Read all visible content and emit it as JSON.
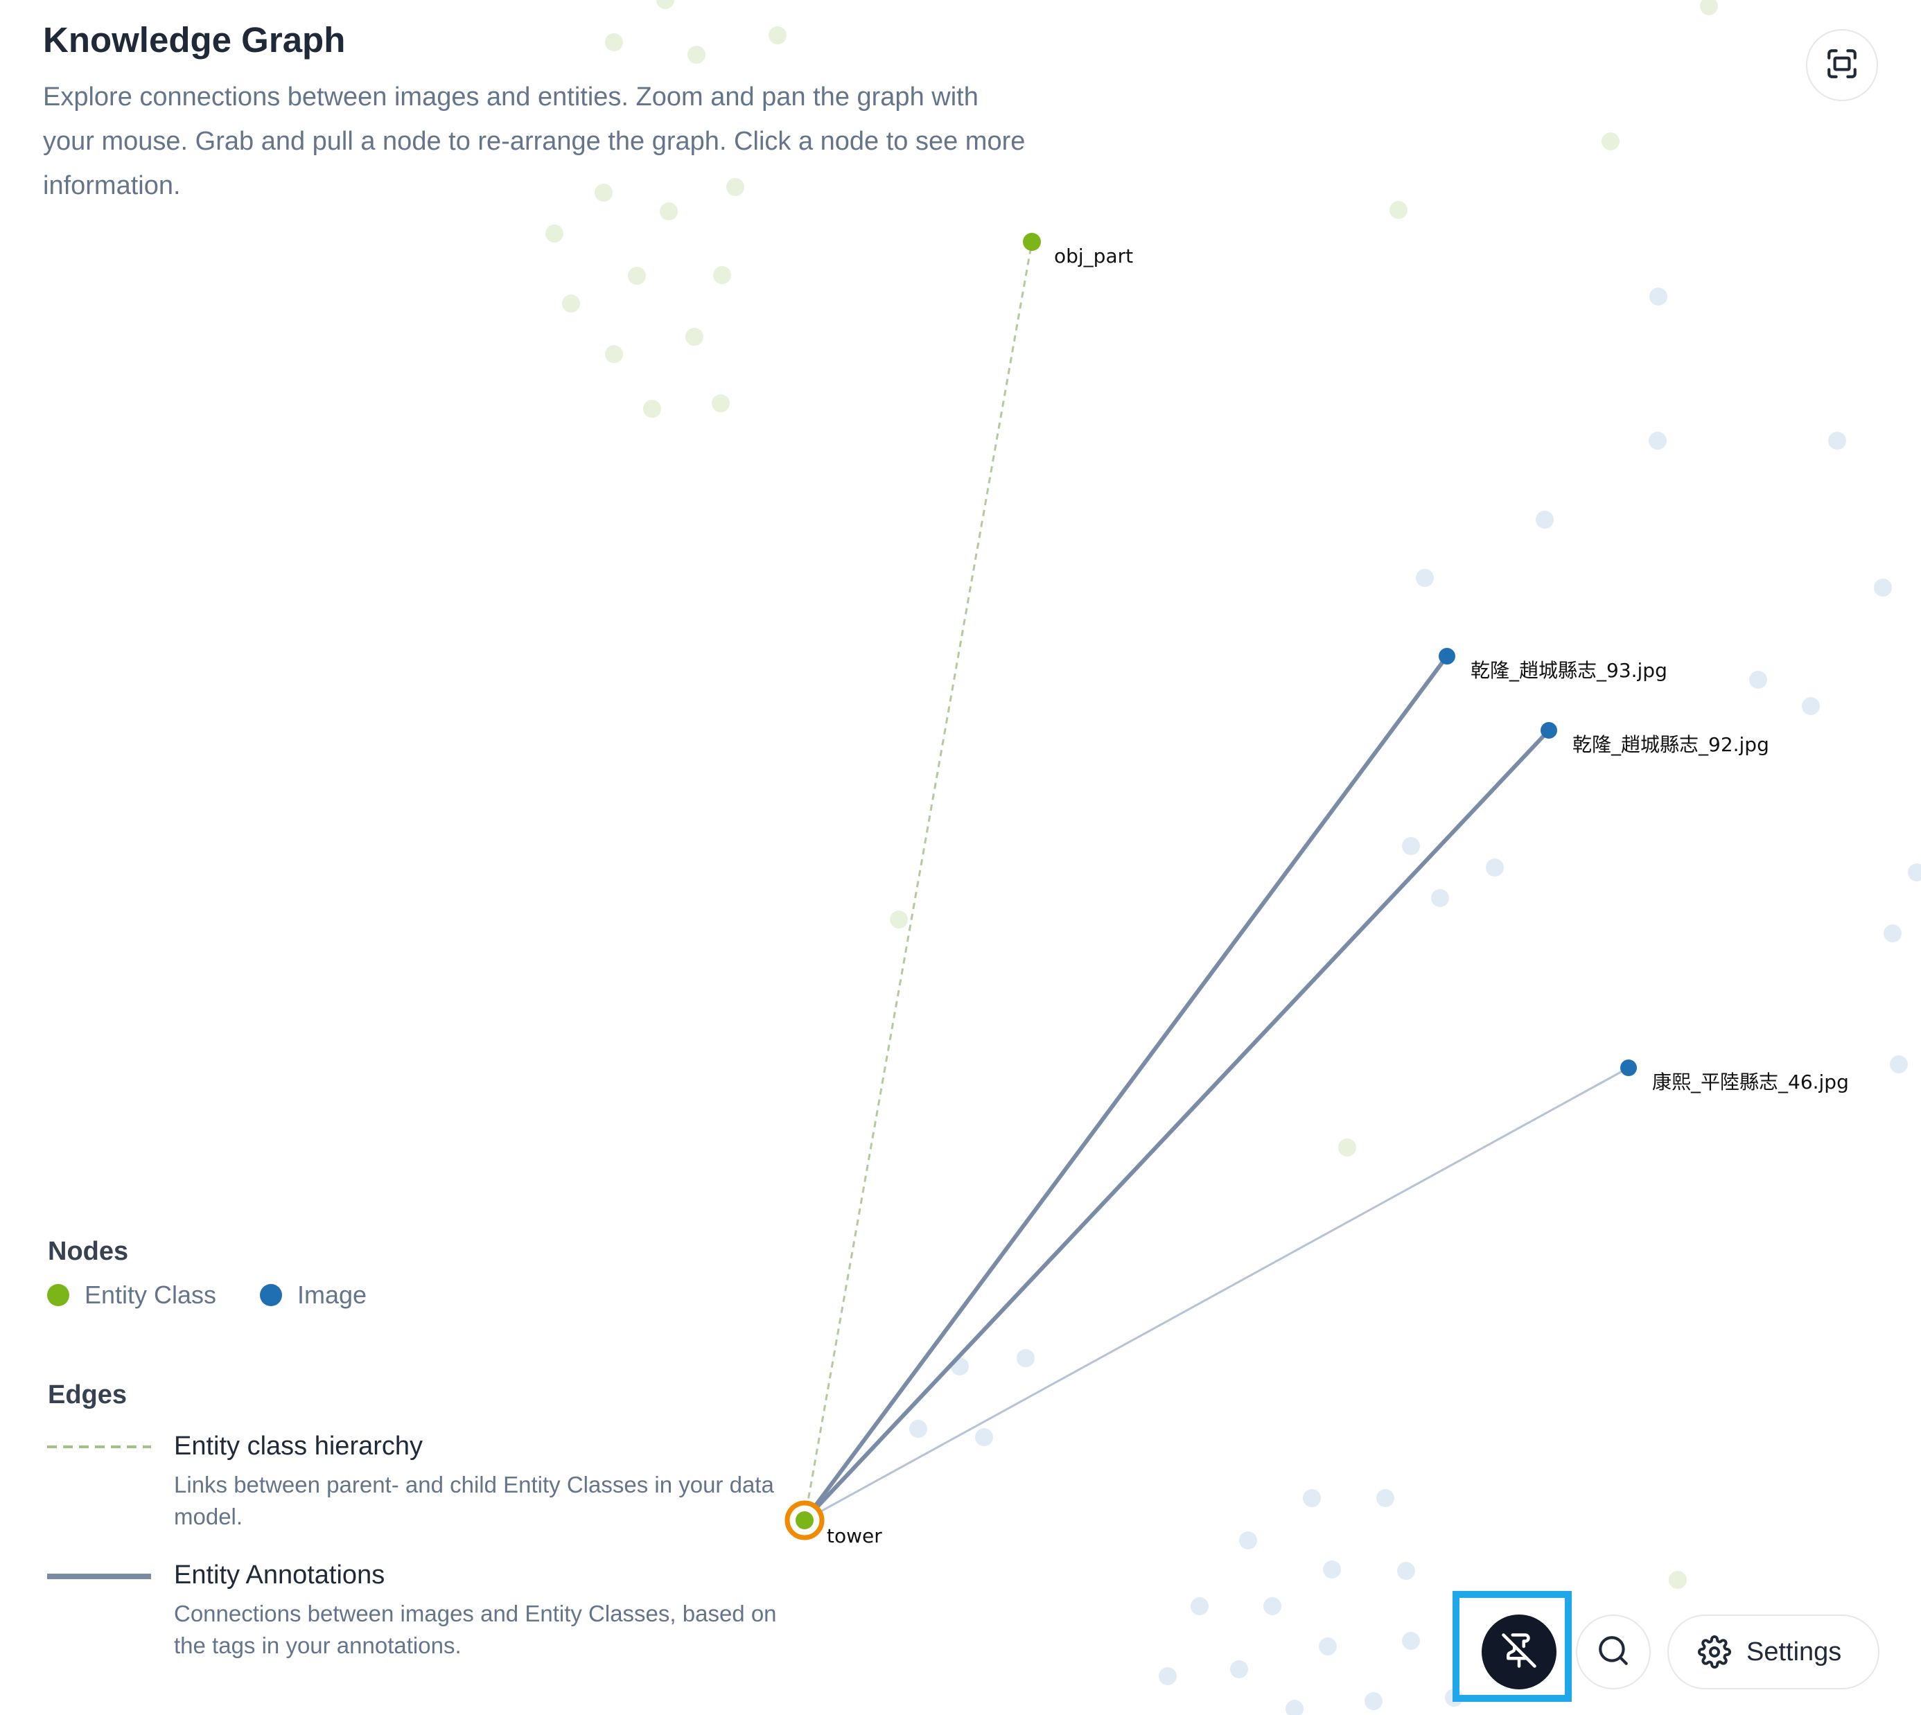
{
  "header": {
    "title": "Knowledge Graph",
    "description": "Explore connections between images and entities. Zoom and pan the graph with your mouse. Grab and pull a node to re-arrange the graph. Click a node to see more information."
  },
  "toolbar": {
    "fit_view_icon": "fit-screen-icon",
    "pin_toggle_icon": "pin-off-icon",
    "search_icon": "search-icon",
    "settings_icon": "gear-icon",
    "settings_label": "Settings"
  },
  "legend": {
    "nodes_heading": "Nodes",
    "node_types": [
      {
        "label": "Entity Class",
        "color": "#7cb518"
      },
      {
        "label": "Image",
        "color": "#1f6fb2"
      }
    ],
    "edges_heading": "Edges",
    "edge_types": [
      {
        "title": "Entity class hierarchy",
        "description": "Links between parent- and child Entity Classes in your data model.",
        "style": "dashed",
        "color": "#a3c28a"
      },
      {
        "title": "Entity Annotations",
        "description": "Connections between images and Entity Classes, based on the tags in your annotations.",
        "style": "solid",
        "color": "#7a8ba6"
      }
    ]
  },
  "graph": {
    "nodes": [
      {
        "id": "obj_part",
        "label": "obj_part",
        "type": "entity_class"
      },
      {
        "id": "tower",
        "label": "tower",
        "type": "entity_class",
        "selected": true
      },
      {
        "id": "img93",
        "label": "乾隆_趙城縣志_93.jpg",
        "type": "image"
      },
      {
        "id": "img92",
        "label": "乾隆_趙城縣志_92.jpg",
        "type": "image"
      },
      {
        "id": "img46",
        "label": "康熙_平陸縣志_46.jpg",
        "type": "image"
      }
    ],
    "edges": [
      {
        "source": "tower",
        "target": "obj_part",
        "kind": "hierarchy"
      },
      {
        "source": "tower",
        "target": "img93",
        "kind": "annotation"
      },
      {
        "source": "tower",
        "target": "img92",
        "kind": "annotation"
      },
      {
        "source": "tower",
        "target": "img46",
        "kind": "annotation-faded"
      }
    ],
    "colors": {
      "entity_class": "#7cb518",
      "image": "#1f6fb2",
      "selected_ring": "#f08a00",
      "faded_entity": "#e7f1dc",
      "faded_image": "#e1ebf6"
    }
  }
}
